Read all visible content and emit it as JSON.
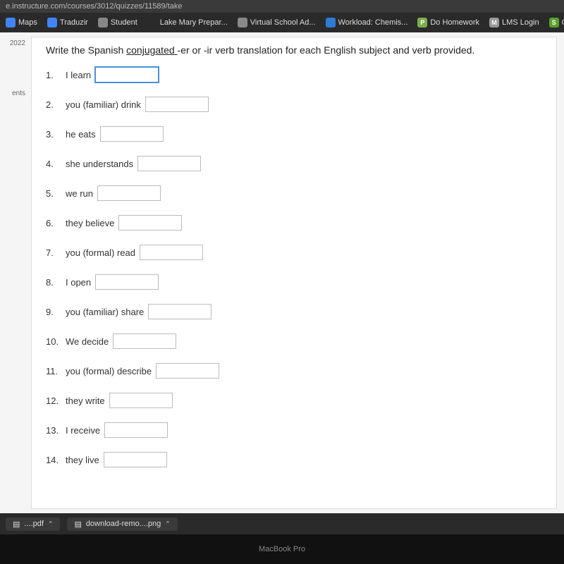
{
  "url": "e.instructure.com/courses/3012/quizzes/11589/take",
  "bookmarks": [
    {
      "label": "Maps",
      "icon_bg": "#4285f4",
      "icon_char": ""
    },
    {
      "label": "Traduzir",
      "icon_bg": "#4285f4",
      "icon_char": ""
    },
    {
      "label": "Student",
      "icon_bg": "#888",
      "icon_char": ""
    },
    {
      "label": "Lake Mary Prepar...",
      "icon_bg": "",
      "icon_char": ""
    },
    {
      "label": "Virtual School Ad...",
      "icon_bg": "#888",
      "icon_char": ""
    },
    {
      "label": "Workload: Chemis...",
      "icon_bg": "#2e7bd6",
      "icon_char": ""
    },
    {
      "label": "Do Homework",
      "icon_bg": "#7aad4b",
      "icon_char": "P"
    },
    {
      "label": "LMS Login",
      "icon_bg": "#999",
      "icon_char": "M"
    },
    {
      "label": "O Sejda ajuda em...",
      "icon_bg": "#5aa02c",
      "icon_char": "S"
    }
  ],
  "sidebar": {
    "item1": "2022",
    "item2": "ents"
  },
  "instructions_pre": "Write the Spanish ",
  "instructions_under": "conjugated ",
  "instructions_post": "-er or -ir verb translation for each English subject and verb provided.",
  "questions": [
    {
      "n": "1.",
      "label": "I learn",
      "value": "",
      "focused": true
    },
    {
      "n": "2.",
      "label": "you (familiar) drink",
      "value": "",
      "focused": false
    },
    {
      "n": "3.",
      "label": "he eats",
      "value": "",
      "focused": false
    },
    {
      "n": "4.",
      "label": "she understands",
      "value": "",
      "focused": false
    },
    {
      "n": "5.",
      "label": "we run",
      "value": "",
      "focused": false
    },
    {
      "n": "6.",
      "label": "they believe",
      "value": "",
      "focused": false
    },
    {
      "n": "7.",
      "label": "you (formal) read",
      "value": "",
      "focused": false
    },
    {
      "n": "8.",
      "label": "I open",
      "value": "",
      "focused": false
    },
    {
      "n": "9.",
      "label": "you (familiar) share",
      "value": "",
      "focused": false
    },
    {
      "n": "10.",
      "label": "We decide",
      "value": "",
      "focused": false
    },
    {
      "n": "11.",
      "label": "you (formal) describe",
      "value": "",
      "focused": false
    },
    {
      "n": "12.",
      "label": "they write",
      "value": "",
      "focused": false
    },
    {
      "n": "13.",
      "label": "I receive",
      "value": "",
      "focused": false
    },
    {
      "n": "14.",
      "label": "they live",
      "value": "",
      "focused": false
    }
  ],
  "downloads": [
    {
      "label": "....pdf",
      "chev": "⌃"
    },
    {
      "label": "download-remo....png",
      "chev": "⌃"
    }
  ],
  "device_label": "MacBook Pro"
}
